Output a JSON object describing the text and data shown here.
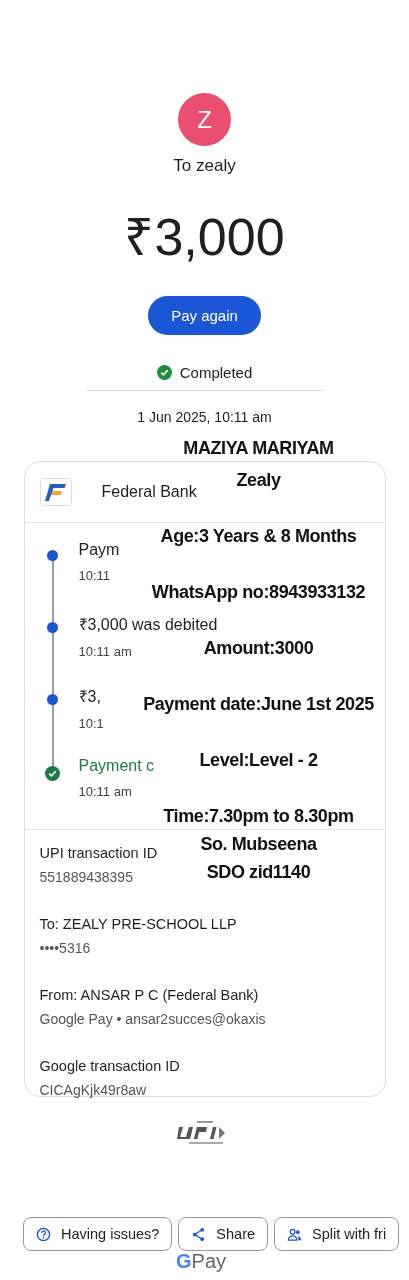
{
  "payee": {
    "initial": "Z",
    "name": "To zealy"
  },
  "amount": "₹3,000",
  "pay_again": "Pay again",
  "status": {
    "label": "Completed"
  },
  "date": "1 Jun 2025, 10:11 am",
  "bank": {
    "name": "Federal Bank"
  },
  "timeline": [
    {
      "kind": "step",
      "title": "Paym",
      "time": "10:11"
    },
    {
      "kind": "step",
      "title": "₹3,000 was debited",
      "time": "10:11 am"
    },
    {
      "kind": "step",
      "title": "₹3,",
      "time": "10:1"
    },
    {
      "kind": "done",
      "title": "Payment c",
      "time": "10:11 am"
    }
  ],
  "details": [
    {
      "label": "UPI transaction ID",
      "value": "551889438395"
    },
    {
      "label": "To: ZEALY PRE-SCHOOL LLP",
      "value": "••••5316"
    },
    {
      "label": "From: ANSAR P C (Federal Bank)",
      "value": "Google Pay • ansar2succes@okaxis"
    },
    {
      "label": "Google transaction ID",
      "value": "CICAgKjk49r8aw"
    }
  ],
  "actions": [
    {
      "kind": "help",
      "label": "Having issues?"
    },
    {
      "kind": "share",
      "label": "Share"
    },
    {
      "kind": "split",
      "label": "Split with fri"
    }
  ],
  "gpay_logo": {
    "mark": "G",
    "text": "Pay"
  },
  "overlay": [
    "MAZIYA MARIYAM",
    "Zealy",
    "Age:3 Years & 8 Months",
    "WhatsApp no:8943933132",
    "Amount:3000",
    "Payment date:June 1st 2025",
    "Level:Level - 2",
    "Time:7.30pm to 8.30pm",
    "So. Mubseena",
    "SDO zid1140"
  ]
}
